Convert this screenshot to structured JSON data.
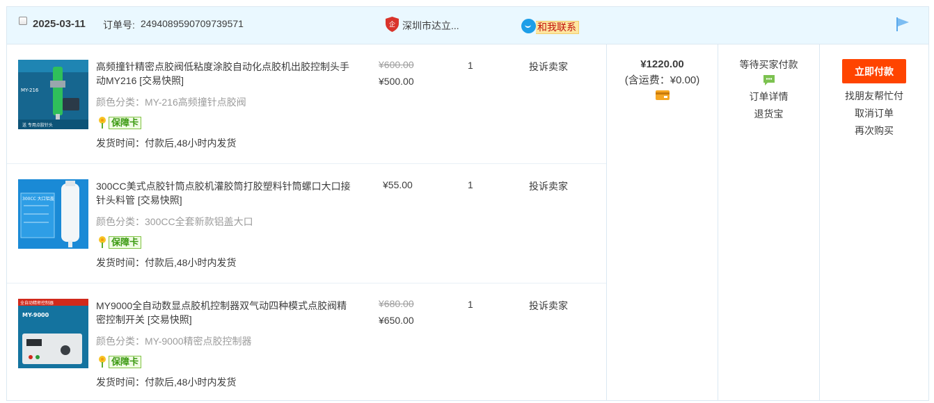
{
  "order": {
    "date": "2025-03-11",
    "order_no_label": "订单号:",
    "order_no": "2494089590709739571",
    "shop_name": "深圳市达立...",
    "contact_label": "和我联系",
    "total": "¥1220.00",
    "freight": "(含运费：¥0.00)",
    "status": "等待买家付款",
    "status_links": [
      "订单详情",
      "退货宝"
    ],
    "pay_button": "立即付款",
    "ops_links": [
      "找朋友帮忙付",
      "取消订单",
      "再次购买"
    ]
  },
  "items": [
    {
      "title": "高频撞针精密点胶阀低粘度涂胶自动化点胶机出胶控制头手动MY216 [交易快照]",
      "sku": "颜色分类：MY-216高频撞针点胶阀",
      "guarantee": "保障卡",
      "ship": "发货时间：付款后,48小时内发货",
      "price_old": "¥600.00",
      "price_new": "¥500.00",
      "qty": "1",
      "complain": "投诉卖家",
      "thumb_caption": "MY-216",
      "thumb_bottom": "送 专用点胶针头"
    },
    {
      "title": "300CC美式点胶针筒点胶机灌胶筒打胶塑料针筒螺口大口接针头料管 [交易快照]",
      "sku": "颜色分类：300CC全套新款铝盖大口",
      "guarantee": "保障卡",
      "ship": "发货时间：付款后,48小时内发货",
      "price_single": "¥55.00",
      "qty": "1",
      "complain": "投诉卖家",
      "thumb_caption": "300CC 大口铝盖"
    },
    {
      "title": "MY9000全自动数显点胶机控制器双气动四种模式点胶阀精密控制开关 [交易快照]",
      "sku": "颜色分类：MY-9000精密点胶控制器",
      "guarantee": "保障卡",
      "ship": "发货时间：付款后,48小时内发货",
      "price_old": "¥680.00",
      "price_new": "¥650.00",
      "qty": "1",
      "complain": "投诉卖家",
      "thumb_caption": "全自动精密控制器",
      "thumb_model": "MY-9000"
    }
  ]
}
